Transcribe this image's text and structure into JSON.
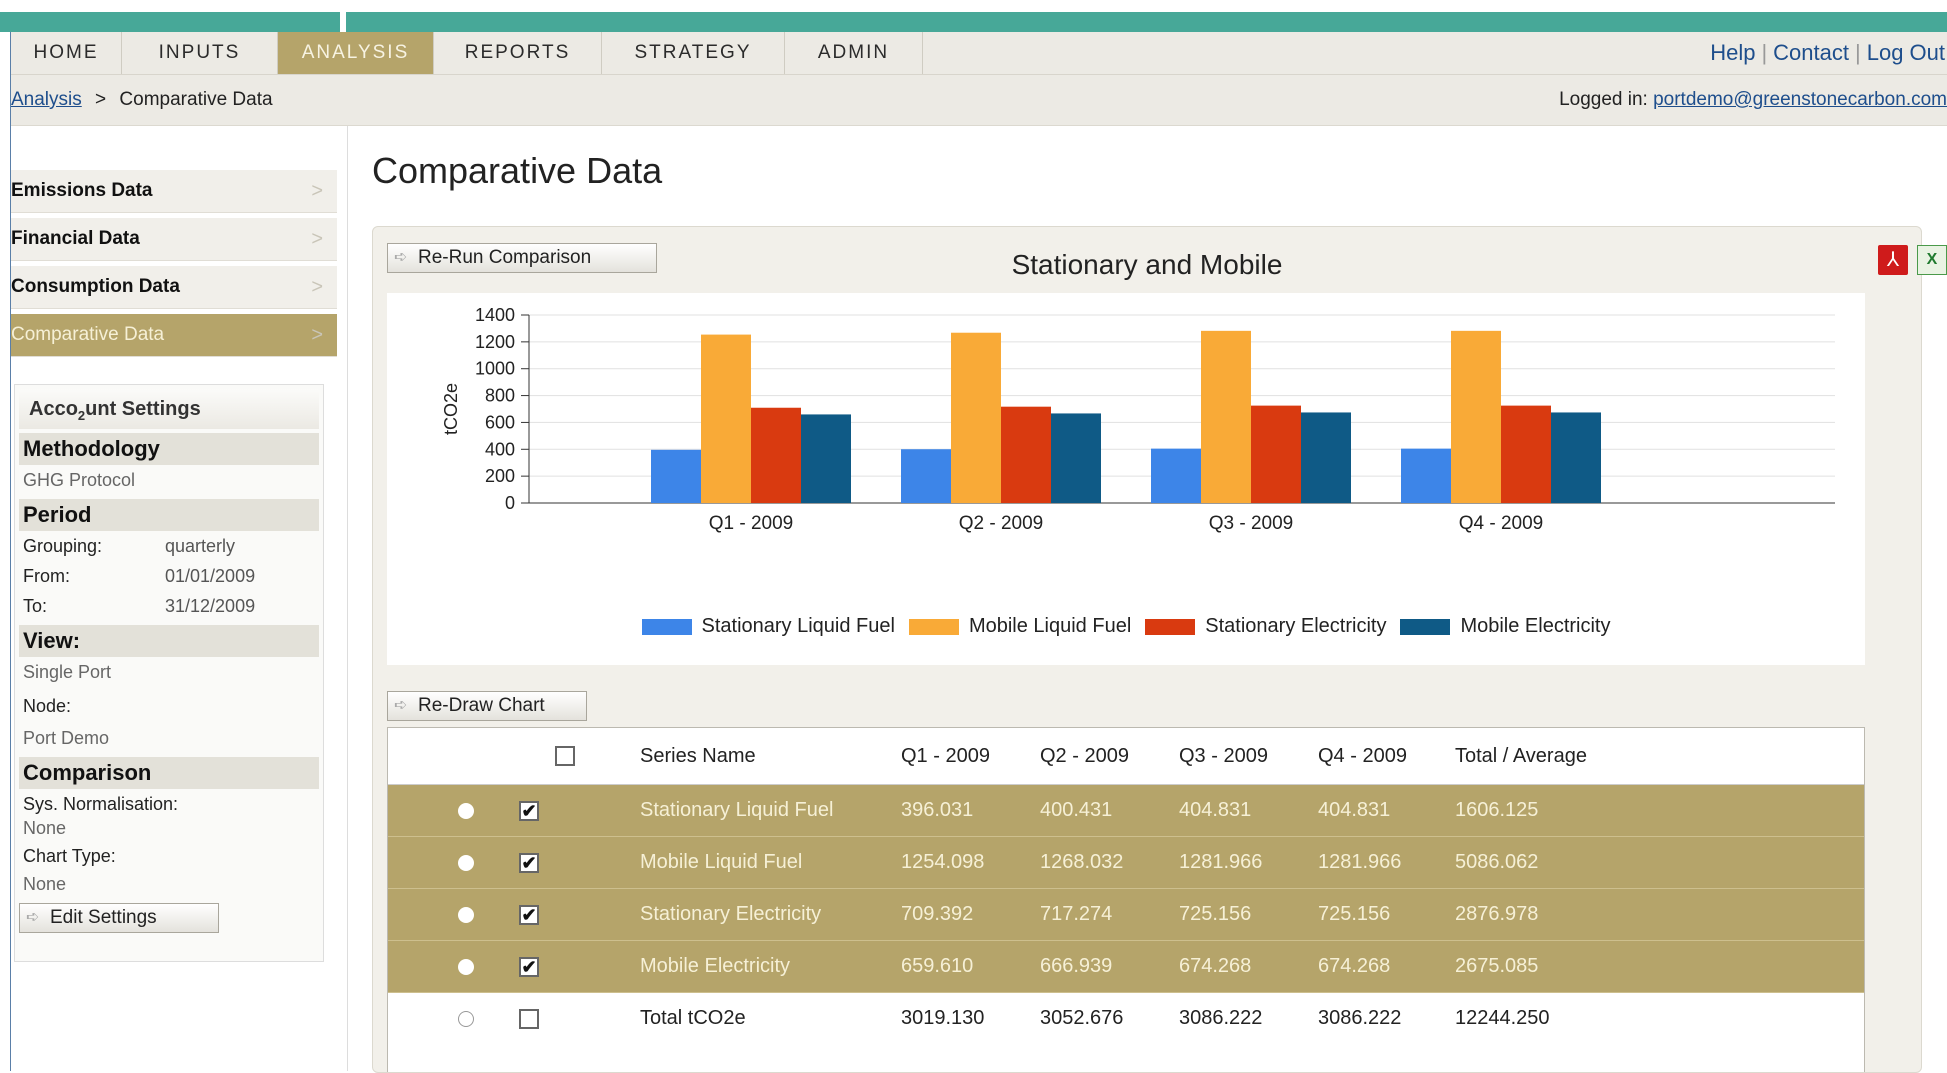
{
  "nav": {
    "tabs": [
      {
        "label": "HOME"
      },
      {
        "label": "INPUTS"
      },
      {
        "label": "ANALYSIS"
      },
      {
        "label": "REPORTS"
      },
      {
        "label": "STRATEGY"
      },
      {
        "label": "ADMIN"
      }
    ],
    "active_tab": "ANALYSIS",
    "links": {
      "help": "Help",
      "contact": "Contact",
      "logout": "Log Out"
    }
  },
  "breadcrumb": {
    "parent": "Analysis",
    "separator": ">",
    "current": "Comparative Data"
  },
  "user": {
    "logged_label": "Logged in:",
    "email": "portdemo@greenstonecarbon.com"
  },
  "sidebar": {
    "items": [
      {
        "label": "Emissions Data"
      },
      {
        "label": "Financial Data"
      },
      {
        "label": "Consumption Data"
      },
      {
        "label": "Comparative Data"
      }
    ],
    "active": "Comparative Data",
    "chevron": ">"
  },
  "account": {
    "title_prefix": "Acco",
    "title_sub": "2",
    "title_suffix": "unt Settings",
    "methodology_heading": "Methodology",
    "methodology_value": "GHG Protocol",
    "period_heading": "Period",
    "grouping_label": "Grouping:",
    "grouping_value": "quarterly",
    "from_label": "From:",
    "from_value": "01/01/2009",
    "to_label": "To:",
    "to_value": "31/12/2009",
    "view_heading": "View:",
    "view_value": "Single Port",
    "node_label": "Node:",
    "node_value": "Port Demo",
    "comparison_heading": "Comparison",
    "normalisation_label": "Sys. Normalisation:",
    "normalisation_value": "None",
    "chart_type_label": "Chart Type:",
    "chart_type_value": "None",
    "edit_button": "Edit Settings"
  },
  "page": {
    "title": "Comparative Data",
    "rerun_button": "Re-Run Comparison",
    "redraw_button": "Re-Draw Chart",
    "export_pdf_icon": "pdf-icon",
    "export_excel_icon": "excel-icon",
    "pdf_glyph": "⅄",
    "xls_glyph": "X"
  },
  "chart_data": {
    "type": "bar",
    "title": "Stationary and Mobile",
    "ylabel": "tCO2e",
    "xlabel": "",
    "categories": [
      "Q1 - 2009",
      "Q2 - 2009",
      "Q3 - 2009",
      "Q4 - 2009"
    ],
    "ylim": [
      0,
      1400
    ],
    "yticks": [
      0,
      200,
      400,
      600,
      800,
      1000,
      1200,
      1400
    ],
    "grid": true,
    "legend_position": "bottom",
    "series": [
      {
        "name": "Stationary Liquid Fuel",
        "color": "#3d85e8",
        "values": [
          396.031,
          400.431,
          404.831,
          404.831
        ]
      },
      {
        "name": "Mobile Liquid Fuel",
        "color": "#f9aa37",
        "values": [
          1254.098,
          1268.032,
          1281.966,
          1281.966
        ]
      },
      {
        "name": "Stationary Electricity",
        "color": "#d93a10",
        "values": [
          709.392,
          717.274,
          725.156,
          725.156
        ]
      },
      {
        "name": "Mobile Electricity",
        "color": "#0f5a86",
        "values": [
          659.61,
          666.939,
          674.268,
          674.268
        ]
      }
    ]
  },
  "table": {
    "headers": [
      "Series Name",
      "Q1 - 2009",
      "Q2 - 2009",
      "Q3 - 2009",
      "Q4 - 2009",
      "Total / Average"
    ],
    "rows": [
      {
        "checked": true,
        "selected": true,
        "cells": [
          "Stationary Liquid Fuel",
          "396.031",
          "400.431",
          "404.831",
          "404.831",
          "1606.125"
        ]
      },
      {
        "checked": true,
        "selected": true,
        "cells": [
          "Mobile Liquid Fuel",
          "1254.098",
          "1268.032",
          "1281.966",
          "1281.966",
          "5086.062"
        ]
      },
      {
        "checked": true,
        "selected": true,
        "cells": [
          "Stationary Electricity",
          "709.392",
          "717.274",
          "725.156",
          "725.156",
          "2876.978"
        ]
      },
      {
        "checked": true,
        "selected": true,
        "cells": [
          "Mobile Electricity",
          "659.610",
          "666.939",
          "674.268",
          "674.268",
          "2675.085"
        ]
      },
      {
        "checked": false,
        "selected": false,
        "cells": [
          "Total tCO2e",
          "3019.130",
          "3052.676",
          "3086.222",
          "3086.222",
          "12244.250"
        ]
      }
    ]
  }
}
